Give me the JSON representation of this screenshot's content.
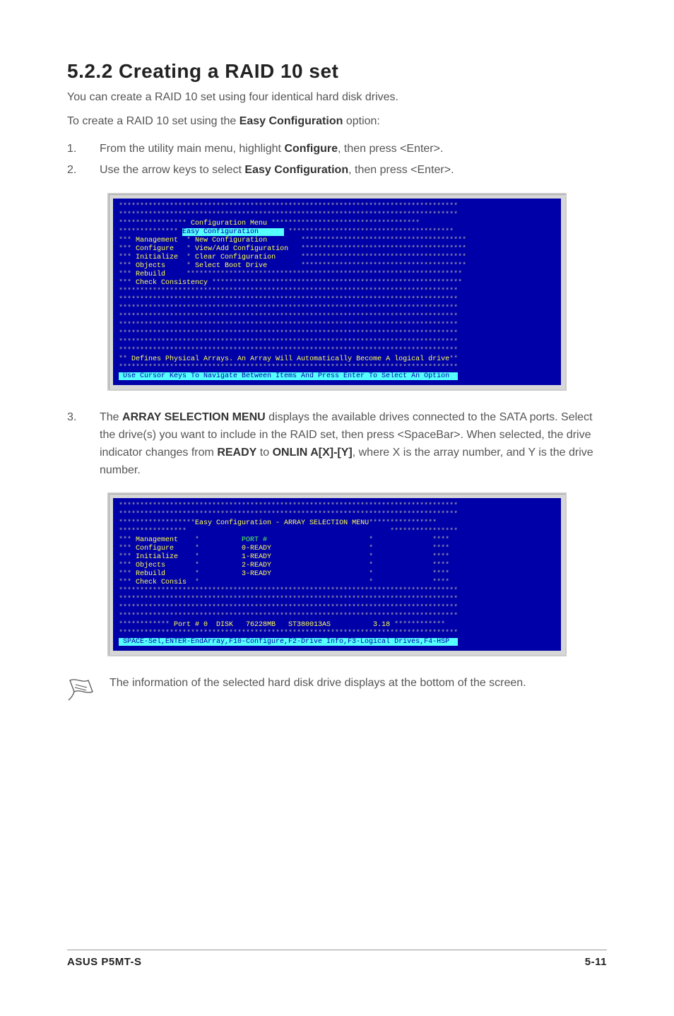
{
  "heading": "5.2.2   Creating a RAID 10 set",
  "intro": "You can create a RAID 10 set using four identical hard disk drives.",
  "lead_pre": "To create a RAID 10 set using the ",
  "lead_bold": "Easy Configuration",
  "lead_post": " option:",
  "steps": [
    {
      "num": "1.",
      "parts": [
        {
          "t": "From the utility main menu, highlight "
        },
        {
          "t": "Configure",
          "b": true
        },
        {
          "t": ", then press <Enter>."
        }
      ]
    },
    {
      "num": "2.",
      "parts": [
        {
          "t": "Use the arrow keys to select "
        },
        {
          "t": "Easy Configuration",
          "b": true
        },
        {
          "t": ", then press <Enter>."
        }
      ]
    }
  ],
  "term1": {
    "title": "Configuration Menu",
    "highlight": "Easy Configuration",
    "left": [
      "Management",
      "Configure",
      "Initialize",
      "Objects",
      "Rebuild",
      "Check Consistency"
    ],
    "right": [
      "New Configuration",
      "View/Add Configuration",
      "Clear Configuration",
      "Select Boot Drive"
    ],
    "hint": "Defines Physical Arrays. An Array Will Automatically Become A logical drive",
    "footer": "Use Cursor Keys To Navigate Between Items And Press Enter To Select An Option"
  },
  "step3": {
    "num": "3.",
    "parts": [
      {
        "t": "The "
      },
      {
        "t": "ARRAY SELECTION MENU",
        "b": true
      },
      {
        "t": " displays the available drives connected to the SATA ports. Select the drive(s) you want to include in the RAID set, then press <SpaceBar>. When selected, the drive indicator changes from "
      },
      {
        "t": "READY",
        "b": true
      },
      {
        "t": "  to  "
      },
      {
        "t": "ONLIN A[X]-[Y]",
        "b": true
      },
      {
        "t": ", where X is the array number, and Y is the drive number."
      }
    ]
  },
  "term2": {
    "title": "Easy Configuration - ARRAY SELECTION MENU",
    "left": [
      "Management",
      "Configure",
      "Initialize",
      "Objects",
      "Rebuild",
      "Check Consis"
    ],
    "ports": [
      "PORT #",
      "0-READY",
      "1-READY",
      "2-READY",
      "3-READY"
    ],
    "detail_label": "Port # 0  DISK   76228MB   ST380013AS          3.18",
    "footer": "SPACE-Sel,ENTER-EndArray,F10-Configure,F2-Drive Info,F3-Logical Drives,F4-HSP"
  },
  "note": "The information of the selected hard disk drive displays at the bottom of the screen.",
  "footer": {
    "left": "ASUS P5MT-S",
    "right": "5-11"
  }
}
